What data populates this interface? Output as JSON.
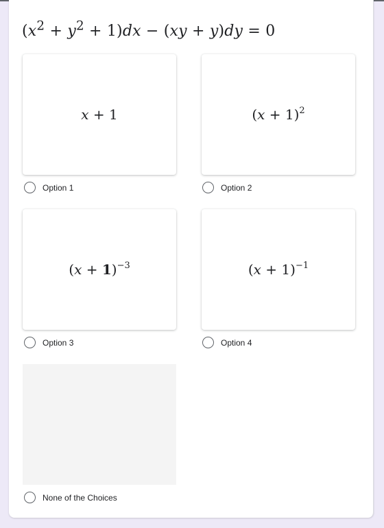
{
  "question": {
    "equation": "(x² + y² + 1)dx − (xy + y)dy = 0"
  },
  "options": [
    {
      "label": "Option 1",
      "image_math": "x + 1",
      "base": "x + 1",
      "exponent": "",
      "selected": false
    },
    {
      "label": "Option 2",
      "image_math": "(x + 1)^2",
      "base": "(x + 1)",
      "exponent": "2",
      "selected": false
    },
    {
      "label": "Option 3",
      "image_math": "(x + 1)^-3",
      "base": "(x + 1)",
      "exponent": "−3",
      "selected": false
    },
    {
      "label": "Option 4",
      "image_math": "(x + 1)^-1",
      "base": "(x + 1)",
      "exponent": "−1",
      "selected": false
    },
    {
      "label": "None of the Choices",
      "image_math": "",
      "base": "",
      "exponent": "",
      "selected": false
    }
  ],
  "colors": {
    "page_background": "#ede9f7",
    "card_background": "#ffffff",
    "text": "#202124",
    "radio_border": "#5f6368",
    "empty_tile": "#f4f4f4"
  }
}
